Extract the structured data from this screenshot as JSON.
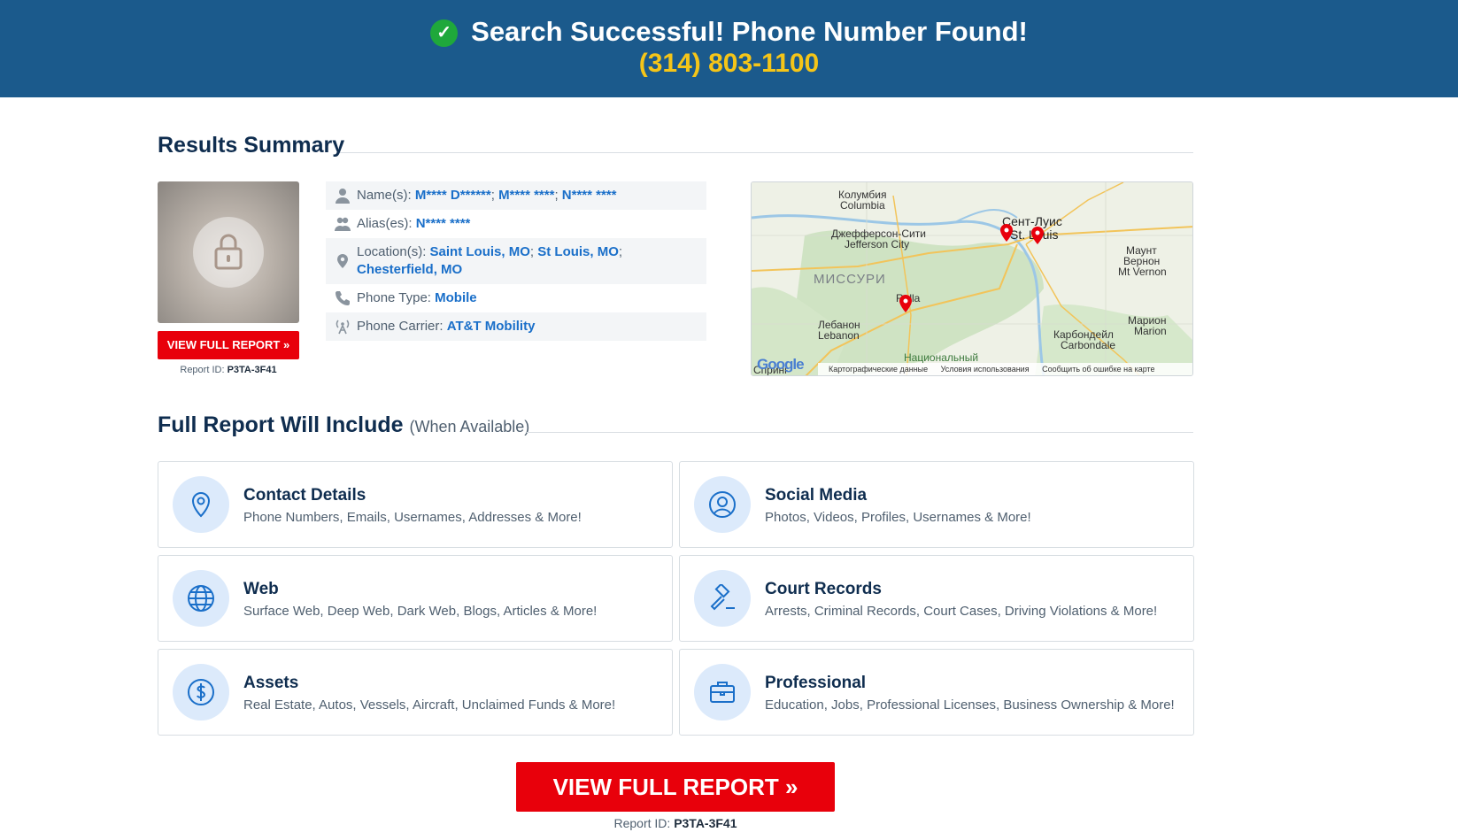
{
  "banner": {
    "title": "Search Successful! Phone Number Found!",
    "phone": "(314) 803-1100",
    "colors": {
      "background": "#1b5a8c",
      "phone": "#f5c518",
      "check": "#1fa83b"
    }
  },
  "summary": {
    "heading": "Results Summary",
    "view_button": "VIEW FULL REPORT »",
    "report_id_label": "Report ID:",
    "report_id": "P3TA-3F41",
    "rows": [
      {
        "icon": "person-icon",
        "label": "Name(s):",
        "values": [
          "M**** D******",
          "M**** ****",
          "N**** ****"
        ]
      },
      {
        "icon": "group-icon",
        "label": "Alias(es):",
        "values": [
          "N**** ****"
        ]
      },
      {
        "icon": "location-pin-icon",
        "label": "Location(s):",
        "values": [
          "Saint Louis, MO",
          "St Louis, MO",
          "Chesterfield, MO"
        ]
      },
      {
        "icon": "phone-icon",
        "label": "Phone Type:",
        "values": [
          "Mobile"
        ]
      },
      {
        "icon": "antenna-icon",
        "label": "Phone Carrier:",
        "values": [
          "AT&T Mobility"
        ]
      }
    ]
  },
  "map": {
    "labels": {
      "columbia_ru": "Колумбия",
      "columbia": "Columbia",
      "jefferson_ru": "Джефферсон-Сити",
      "jefferson": "Jefferson City",
      "stlouis_ru": "Сент-Луис",
      "stlouis": "St. Louis",
      "state": "МИССУРИ",
      "mtvernon_ru": "Маунт",
      "mtvernon_ru2": "Вернон",
      "mtvernon": "Mt Vernon",
      "rolla": "Rolla",
      "lebanon_ru": "Лебанон",
      "lebanon": "Lebanon",
      "marion_ru": "Марион",
      "marion": "Marion",
      "carbondale_ru": "Карбондейл",
      "carbondale": "Carbondale",
      "park": "Национальный",
      "spring": "Спринг"
    },
    "footer": {
      "google": "Google",
      "data": "Картографические данные",
      "terms": "Условия использования",
      "report": "Сообщить об ошибке на карте"
    }
  },
  "full_report": {
    "heading": "Full Report Will Include",
    "subheading": "(When Available)",
    "cards": [
      {
        "icon": "map-pin-icon",
        "title": "Contact Details",
        "desc": "Phone Numbers, Emails, Usernames, Addresses & More!"
      },
      {
        "icon": "user-circle-icon",
        "title": "Social Media",
        "desc": "Photos, Videos, Profiles, Usernames & More!"
      },
      {
        "icon": "globe-icon",
        "title": "Web",
        "desc": "Surface Web, Deep Web, Dark Web, Blogs, Articles & More!"
      },
      {
        "icon": "gavel-icon",
        "title": "Court Records",
        "desc": "Arrests, Criminal Records, Court Cases, Driving Violations & More!"
      },
      {
        "icon": "dollar-icon",
        "title": "Assets",
        "desc": "Real Estate, Autos, Vessels, Aircraft, Unclaimed Funds & More!"
      },
      {
        "icon": "briefcase-icon",
        "title": "Professional",
        "desc": "Education, Jobs, Professional Licenses, Business Ownership & More!"
      }
    ]
  },
  "cta": {
    "button": "VIEW FULL REPORT »",
    "report_id_label": "Report ID:",
    "report_id": "P3TA-3F41",
    "color": "#e8000b"
  }
}
